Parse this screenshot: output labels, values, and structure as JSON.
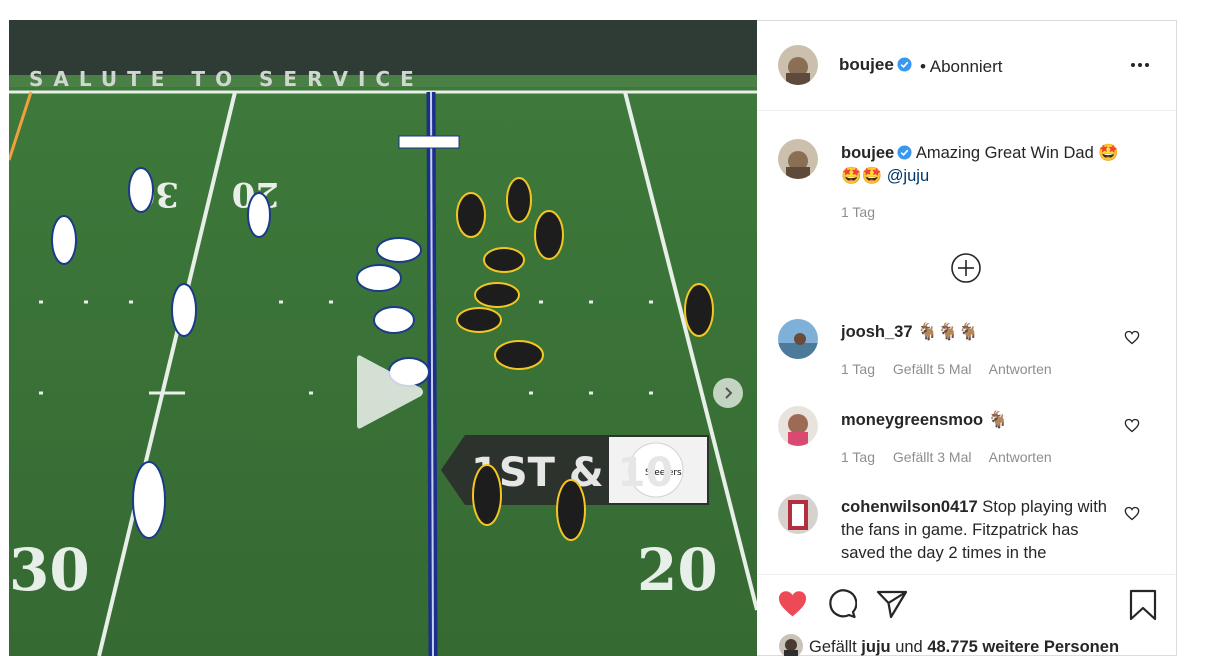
{
  "colors": {
    "accent_like": "#ed4956",
    "verified": "#3897f0",
    "mention": "#00376b",
    "meta": "#8e8e8e"
  },
  "media": {
    "yard_numbers": [
      "30",
      "20",
      "30",
      "20"
    ],
    "banner_text": "SALUTE TO SERVICE",
    "down_marker": "1ST & 10",
    "sponsor": "Steelers"
  },
  "header": {
    "username": "boujee",
    "separator": "•",
    "follow_status": "Abonniert",
    "more_icon": "more-horizontal-icon"
  },
  "caption": {
    "username": "boujee",
    "text_line1": "Amazing Great Win Dad 🤩",
    "text_line2": "🤩🤩",
    "mention": "@juju",
    "time": "1 Tag"
  },
  "comments": [
    {
      "username": "joosh_37",
      "text": "🐐🐐🐐",
      "time": "1 Tag",
      "likes": "Gefällt 5 Mal",
      "reply": "Antworten"
    },
    {
      "username": "moneygreensmoo",
      "text": "🐐",
      "time": "1 Tag",
      "likes": "Gefällt 3 Mal",
      "reply": "Antworten"
    },
    {
      "username": "cohenwilson0417",
      "text": "Stop playing with the fans in game. Fitzpatrick has saved the day 2 times in the",
      "time": "",
      "likes": "",
      "reply": ""
    }
  ],
  "likes_bar": {
    "prefix": "Gefällt",
    "user": "juju",
    "connector": "und",
    "count": "48.775 weitere Personen"
  }
}
